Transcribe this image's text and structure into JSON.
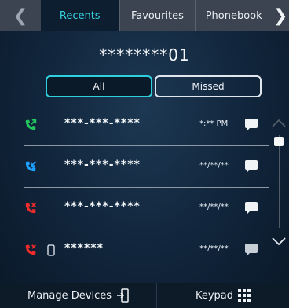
{
  "tabs": {
    "left_arrow": "❮",
    "right_arrow": "❯",
    "items": [
      {
        "label": "Recents"
      },
      {
        "label": "Favourites"
      },
      {
        "label": "Phonebook"
      }
    ]
  },
  "number_display": "********01",
  "filters": {
    "all": "All",
    "missed": "Missed"
  },
  "calls": [
    {
      "type": "outgoing",
      "color": "#22c55e",
      "number": "***-***-****",
      "time": "*:** PM"
    },
    {
      "type": "incoming",
      "color": "#1ea0ff",
      "number": "***-***-****",
      "time": "**/**/**"
    },
    {
      "type": "missed",
      "color": "#ef2b2b",
      "number": "***-***-****",
      "time": "**/**/**"
    },
    {
      "type": "missed",
      "color": "#ef2b2b",
      "number": "******",
      "time": "**/**/**",
      "has_device_icon": true
    }
  ],
  "bottom": {
    "manage": "Manage Devices",
    "keypad": "Keypad"
  },
  "colors": {
    "accent": "#38d3e0",
    "background": "#10243a"
  }
}
